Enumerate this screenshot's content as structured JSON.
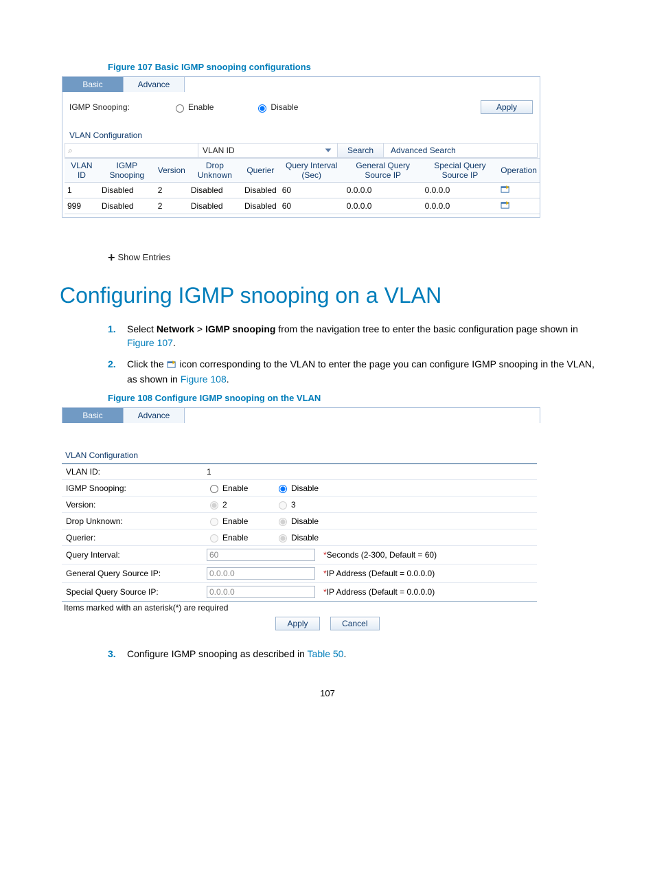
{
  "page_number": "107",
  "figure107": {
    "caption": "Figure 107 Basic IGMP snooping configurations",
    "tabs": {
      "basic": "Basic",
      "advance": "Advance"
    },
    "igmp_label": "IGMP Snooping:",
    "enable": "Enable",
    "disable": "Disable",
    "apply": "Apply",
    "vlan_config": "VLAN Configuration",
    "search_placeholder": "",
    "select_value": "VLAN ID",
    "search_btn": "Search",
    "adv_search": "Advanced Search",
    "headers": [
      "VLAN ID",
      "IGMP Snooping",
      "Version",
      "Drop Unknown",
      "Querier",
      "Query Interval (Sec)",
      "General Query Source IP",
      "Special Query Source IP",
      "Operation"
    ],
    "rows": [
      {
        "vlan": "1",
        "snoop": "Disabled",
        "ver": "2",
        "drop": "Disabled",
        "querier": "Disabled",
        "intv": "60",
        "gq": "0.0.0.0",
        "sq": "0.0.0.0"
      },
      {
        "vlan": "999",
        "snoop": "Disabled",
        "ver": "2",
        "drop": "Disabled",
        "querier": "Disabled",
        "intv": "60",
        "gq": "0.0.0.0",
        "sq": "0.0.0.0"
      }
    ]
  },
  "show_entries": "Show Entries",
  "heading": "Configuring IGMP snooping on a VLAN",
  "steps": {
    "s1a": "Select ",
    "s1b": "Network",
    "s1c": " > ",
    "s1d": "IGMP snooping",
    "s1e": " from the navigation tree to enter the basic configuration page shown in ",
    "s1f": "Figure 107",
    "s1g": ".",
    "s2a": "Click the ",
    "s2b": " icon corresponding to the VLAN to enter the page you can configure IGMP snooping in the VLAN, as shown in ",
    "s2c": "Figure 108",
    "s2d": ".",
    "s3a": "Configure IGMP snooping as described in ",
    "s3b": "Table 50",
    "s3c": "."
  },
  "figure108": {
    "caption": "Figure 108 Configure IGMP snooping on the VLAN",
    "tabs": {
      "basic": "Basic",
      "advance": "Advance"
    },
    "vlan_config": "VLAN Configuration",
    "vlan_id_label": "VLAN ID:",
    "vlan_id_value": "1",
    "igmp_label": "IGMP Snooping:",
    "version_label": "Version:",
    "v2": "2",
    "v3": "3",
    "drop_label": "Drop Unknown:",
    "querier_label": "Querier:",
    "qintv_label": "Query Interval:",
    "qintv_value": "60",
    "qintv_note": "Seconds (2-300, Default = 60)",
    "gq_label": "General Query Source IP:",
    "gq_value": "0.0.0.0",
    "ip_note": "IP Address (Default = 0.0.0.0)",
    "sq_label": "Special Query Source IP:",
    "sq_value": "0.0.0.0",
    "enable": "Enable",
    "disable": "Disable",
    "req_note": "Items marked with an asterisk(*) are required",
    "apply": "Apply",
    "cancel": "Cancel"
  }
}
